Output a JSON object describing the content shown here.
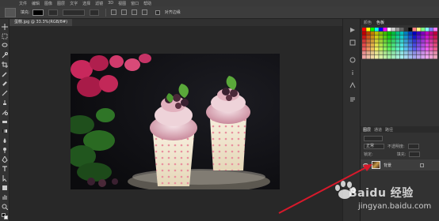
{
  "menu": {
    "items": [
      "文件",
      "编辑",
      "图像",
      "图层",
      "文字",
      "选择",
      "滤镜",
      "3D",
      "视图",
      "窗口",
      "帮助"
    ]
  },
  "options": {
    "fill_label": "填充:",
    "align_label": "对齐边缘"
  },
  "document": {
    "tab_label": "蛋糕.jpg @ 33.3%(RGB/8#)"
  },
  "swatches_panel": {
    "tabs": [
      "颜色",
      "色板"
    ],
    "active_tab": "色板"
  },
  "layers_panel": {
    "tabs": [
      "图层",
      "通道",
      "路径"
    ],
    "active_tab": "图层",
    "blend_mode": "正常",
    "opacity_label": "不透明度:",
    "lock_label": "锁定:",
    "fill_label": "填充:",
    "layer": {
      "name": "背景"
    }
  },
  "watermark": {
    "brand": "Baidu 经验",
    "url": "jingyan.baidu.com"
  },
  "colors": {
    "app_bg": "#282828",
    "panel_bg": "#323232",
    "arrow": "#d8192b"
  },
  "icons": {
    "toolbar": [
      "move-icon",
      "marquee-icon",
      "lasso-icon",
      "quick-select-icon",
      "crop-icon",
      "eyedropper-icon",
      "healing-icon",
      "brush-icon",
      "stamp-icon",
      "history-brush-icon",
      "eraser-icon",
      "gradient-icon",
      "blur-icon",
      "dodge-icon",
      "pen-icon",
      "type-icon",
      "path-select-icon",
      "shape-icon",
      "hand-icon",
      "zoom-icon"
    ]
  }
}
